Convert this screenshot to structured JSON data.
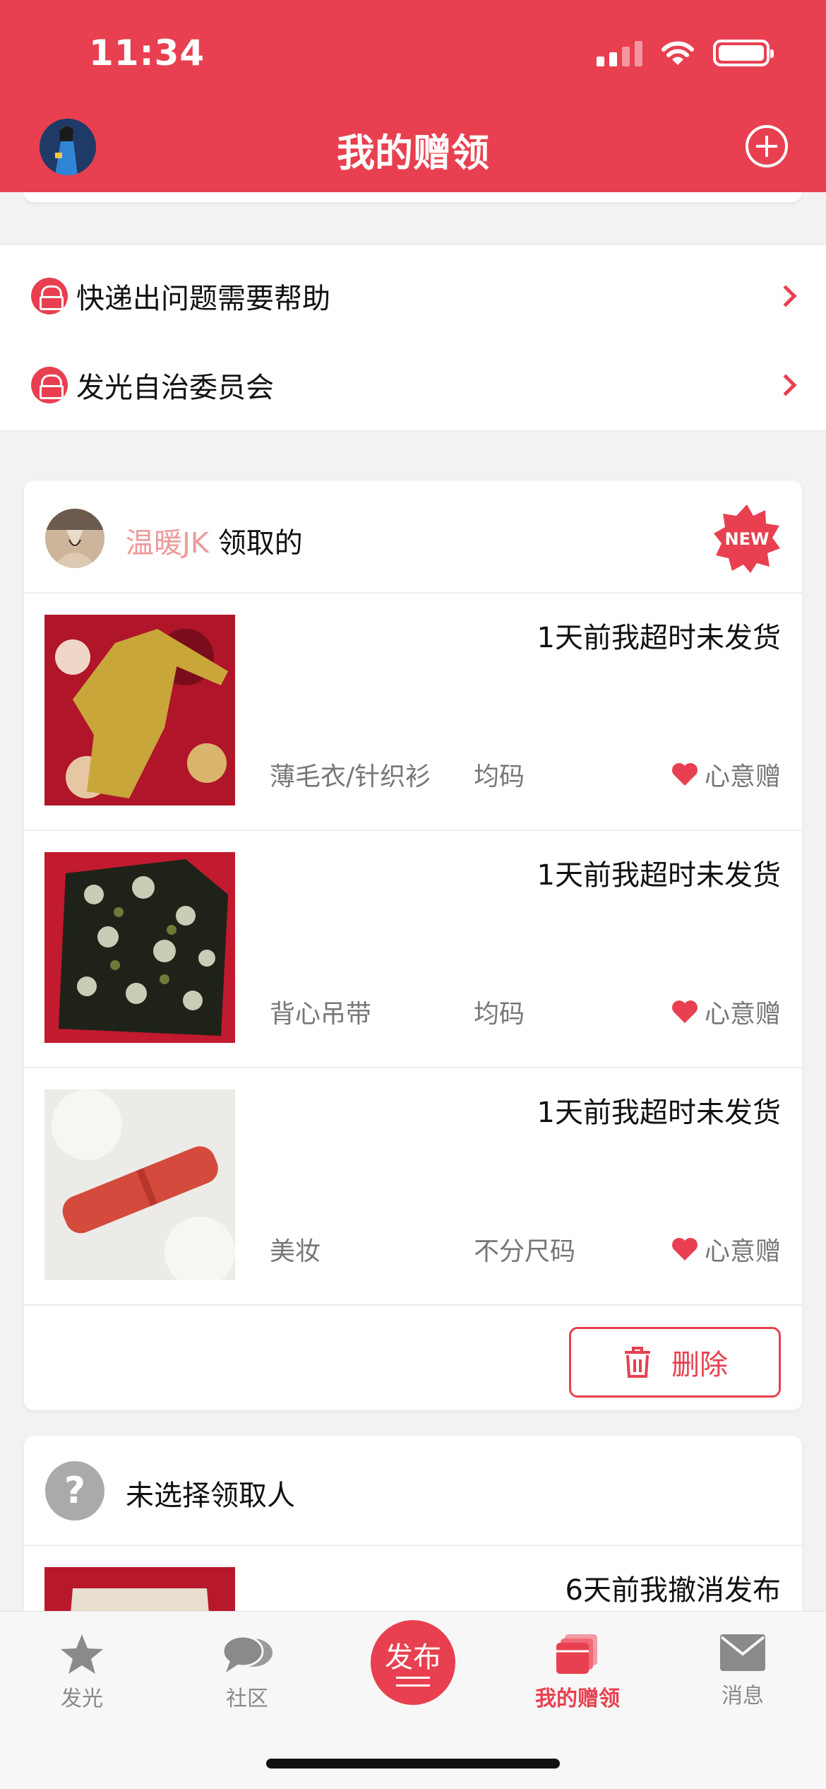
{
  "status_bar": {
    "time": "11:34"
  },
  "header": {
    "title": "我的赠领"
  },
  "help_menu": {
    "items": [
      {
        "label": "快递出问题需要帮助"
      },
      {
        "label": "发光自治委员会"
      }
    ]
  },
  "order_card": {
    "claimer_name": "温暖JK",
    "claimer_suffix": "领取的",
    "badge": "NEW",
    "items": [
      {
        "status": "1天前我超时未发货",
        "category": "薄毛衣/针织衫",
        "size": "均码",
        "gift_type": "心意赠"
      },
      {
        "status": "1天前我超时未发货",
        "category": "背心吊带",
        "size": "均码",
        "gift_type": "心意赠"
      },
      {
        "status": "1天前我超时未发货",
        "category": "美妆",
        "size": "不分尺码",
        "gift_type": "心意赠"
      }
    ],
    "delete_label": "删除"
  },
  "unselected_card": {
    "avatar_glyph": "?",
    "title": "未选择领取人",
    "first_item_status": "6天前我撤消发布"
  },
  "tab_bar": {
    "tabs": [
      {
        "label": "发光",
        "icon": "star-icon"
      },
      {
        "label": "社区",
        "icon": "chat-bubbles-icon"
      },
      {
        "label": "发布",
        "icon": "publish-icon"
      },
      {
        "label": "我的赠领",
        "icon": "gift-cards-icon",
        "active": true
      },
      {
        "label": "消息",
        "icon": "envelope-icon"
      }
    ]
  },
  "colors": {
    "accent": "#e84050",
    "claimer_name": "#ee9a9a",
    "muted": "#8a8a8a"
  }
}
